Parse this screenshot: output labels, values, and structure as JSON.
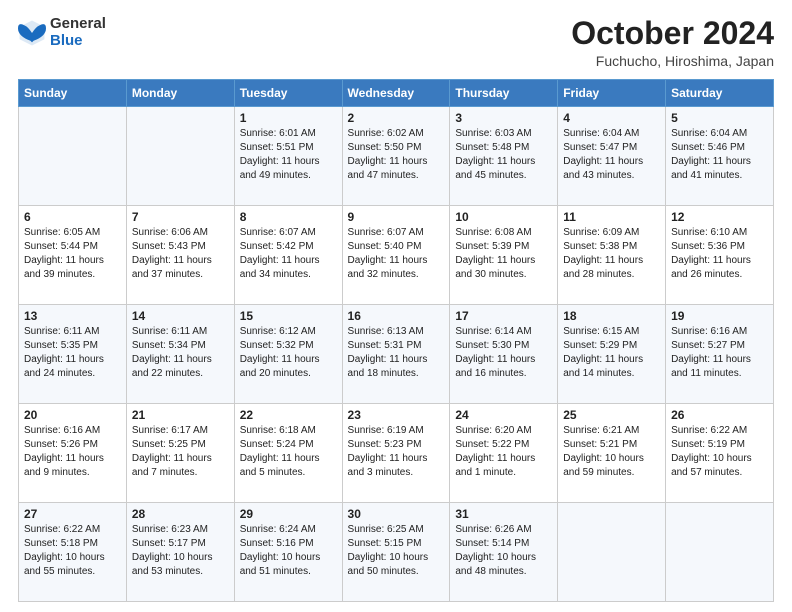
{
  "logo": {
    "general": "General",
    "blue": "Blue"
  },
  "header": {
    "title": "October 2024",
    "subtitle": "Fuchucho, Hiroshima, Japan"
  },
  "weekdays": [
    "Sunday",
    "Monday",
    "Tuesday",
    "Wednesday",
    "Thursday",
    "Friday",
    "Saturday"
  ],
  "weeks": [
    [
      {
        "day": "",
        "info": ""
      },
      {
        "day": "",
        "info": ""
      },
      {
        "day": "1",
        "info": "Sunrise: 6:01 AM\nSunset: 5:51 PM\nDaylight: 11 hours and 49 minutes."
      },
      {
        "day": "2",
        "info": "Sunrise: 6:02 AM\nSunset: 5:50 PM\nDaylight: 11 hours and 47 minutes."
      },
      {
        "day": "3",
        "info": "Sunrise: 6:03 AM\nSunset: 5:48 PM\nDaylight: 11 hours and 45 minutes."
      },
      {
        "day": "4",
        "info": "Sunrise: 6:04 AM\nSunset: 5:47 PM\nDaylight: 11 hours and 43 minutes."
      },
      {
        "day": "5",
        "info": "Sunrise: 6:04 AM\nSunset: 5:46 PM\nDaylight: 11 hours and 41 minutes."
      }
    ],
    [
      {
        "day": "6",
        "info": "Sunrise: 6:05 AM\nSunset: 5:44 PM\nDaylight: 11 hours and 39 minutes."
      },
      {
        "day": "7",
        "info": "Sunrise: 6:06 AM\nSunset: 5:43 PM\nDaylight: 11 hours and 37 minutes."
      },
      {
        "day": "8",
        "info": "Sunrise: 6:07 AM\nSunset: 5:42 PM\nDaylight: 11 hours and 34 minutes."
      },
      {
        "day": "9",
        "info": "Sunrise: 6:07 AM\nSunset: 5:40 PM\nDaylight: 11 hours and 32 minutes."
      },
      {
        "day": "10",
        "info": "Sunrise: 6:08 AM\nSunset: 5:39 PM\nDaylight: 11 hours and 30 minutes."
      },
      {
        "day": "11",
        "info": "Sunrise: 6:09 AM\nSunset: 5:38 PM\nDaylight: 11 hours and 28 minutes."
      },
      {
        "day": "12",
        "info": "Sunrise: 6:10 AM\nSunset: 5:36 PM\nDaylight: 11 hours and 26 minutes."
      }
    ],
    [
      {
        "day": "13",
        "info": "Sunrise: 6:11 AM\nSunset: 5:35 PM\nDaylight: 11 hours and 24 minutes."
      },
      {
        "day": "14",
        "info": "Sunrise: 6:11 AM\nSunset: 5:34 PM\nDaylight: 11 hours and 22 minutes."
      },
      {
        "day": "15",
        "info": "Sunrise: 6:12 AM\nSunset: 5:32 PM\nDaylight: 11 hours and 20 minutes."
      },
      {
        "day": "16",
        "info": "Sunrise: 6:13 AM\nSunset: 5:31 PM\nDaylight: 11 hours and 18 minutes."
      },
      {
        "day": "17",
        "info": "Sunrise: 6:14 AM\nSunset: 5:30 PM\nDaylight: 11 hours and 16 minutes."
      },
      {
        "day": "18",
        "info": "Sunrise: 6:15 AM\nSunset: 5:29 PM\nDaylight: 11 hours and 14 minutes."
      },
      {
        "day": "19",
        "info": "Sunrise: 6:16 AM\nSunset: 5:27 PM\nDaylight: 11 hours and 11 minutes."
      }
    ],
    [
      {
        "day": "20",
        "info": "Sunrise: 6:16 AM\nSunset: 5:26 PM\nDaylight: 11 hours and 9 minutes."
      },
      {
        "day": "21",
        "info": "Sunrise: 6:17 AM\nSunset: 5:25 PM\nDaylight: 11 hours and 7 minutes."
      },
      {
        "day": "22",
        "info": "Sunrise: 6:18 AM\nSunset: 5:24 PM\nDaylight: 11 hours and 5 minutes."
      },
      {
        "day": "23",
        "info": "Sunrise: 6:19 AM\nSunset: 5:23 PM\nDaylight: 11 hours and 3 minutes."
      },
      {
        "day": "24",
        "info": "Sunrise: 6:20 AM\nSunset: 5:22 PM\nDaylight: 11 hours and 1 minute."
      },
      {
        "day": "25",
        "info": "Sunrise: 6:21 AM\nSunset: 5:21 PM\nDaylight: 10 hours and 59 minutes."
      },
      {
        "day": "26",
        "info": "Sunrise: 6:22 AM\nSunset: 5:19 PM\nDaylight: 10 hours and 57 minutes."
      }
    ],
    [
      {
        "day": "27",
        "info": "Sunrise: 6:22 AM\nSunset: 5:18 PM\nDaylight: 10 hours and 55 minutes."
      },
      {
        "day": "28",
        "info": "Sunrise: 6:23 AM\nSunset: 5:17 PM\nDaylight: 10 hours and 53 minutes."
      },
      {
        "day": "29",
        "info": "Sunrise: 6:24 AM\nSunset: 5:16 PM\nDaylight: 10 hours and 51 minutes."
      },
      {
        "day": "30",
        "info": "Sunrise: 6:25 AM\nSunset: 5:15 PM\nDaylight: 10 hours and 50 minutes."
      },
      {
        "day": "31",
        "info": "Sunrise: 6:26 AM\nSunset: 5:14 PM\nDaylight: 10 hours and 48 minutes."
      },
      {
        "day": "",
        "info": ""
      },
      {
        "day": "",
        "info": ""
      }
    ]
  ]
}
